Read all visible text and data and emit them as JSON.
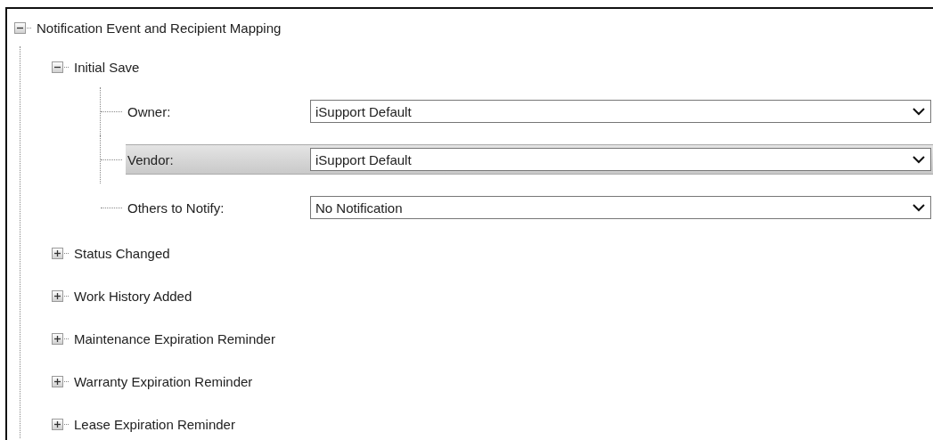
{
  "tree": {
    "label": "Notification Event and Recipient Mapping",
    "expanded": true,
    "children": [
      {
        "label": "Initial Save",
        "expanded": true,
        "fields": [
          {
            "label": "Owner:",
            "value": "iSupport Default",
            "selected": false
          },
          {
            "label": "Vendor:",
            "value": "iSupport Default",
            "selected": true
          },
          {
            "label": "Others to Notify:",
            "value": "No Notification",
            "selected": false
          }
        ]
      },
      {
        "label": "Status Changed",
        "expanded": false
      },
      {
        "label": "Work History Added",
        "expanded": false
      },
      {
        "label": "Maintenance Expiration Reminder",
        "expanded": false
      },
      {
        "label": "Warranty Expiration Reminder",
        "expanded": false
      },
      {
        "label": "Lease Expiration Reminder",
        "expanded": false
      }
    ]
  }
}
